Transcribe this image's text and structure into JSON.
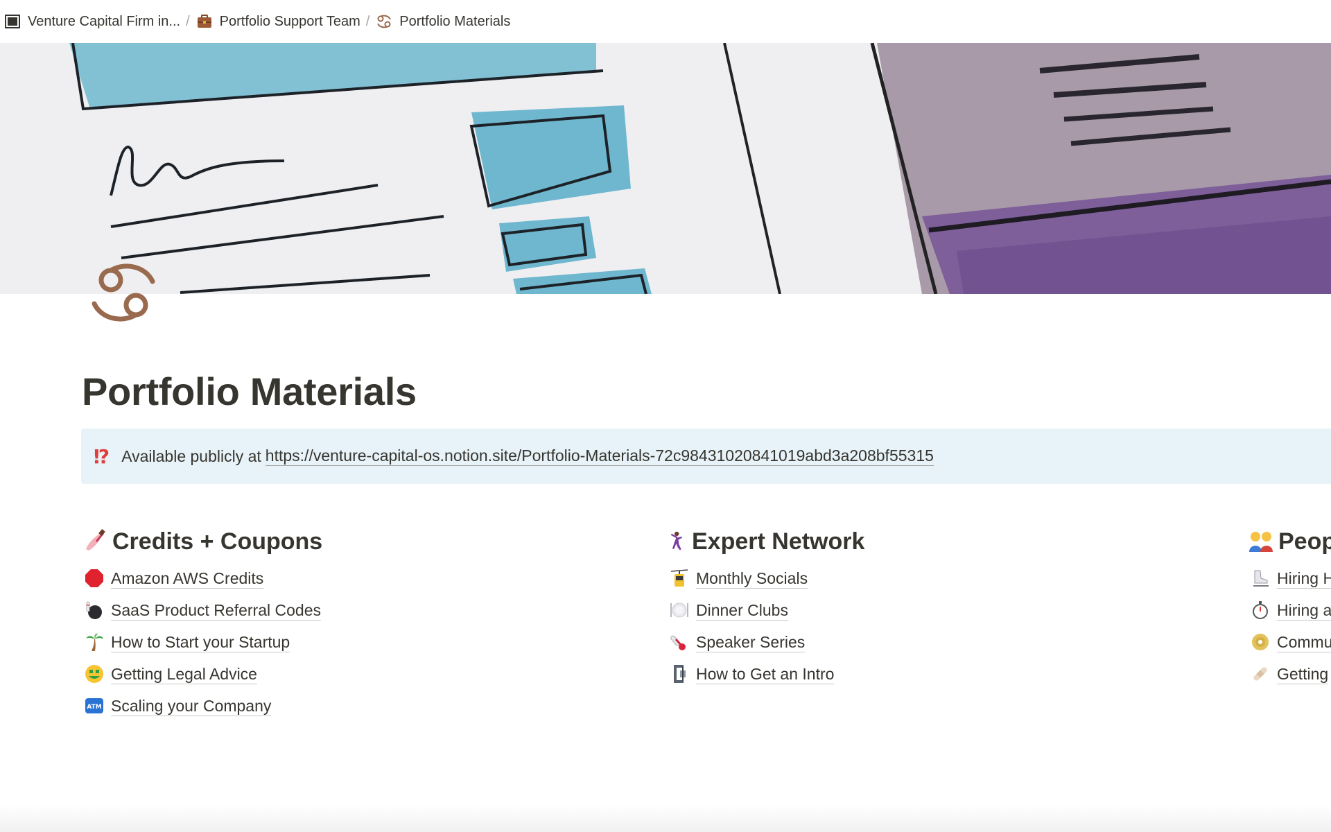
{
  "breadcrumb": [
    {
      "label": "Venture Capital Firm in...",
      "icon": "window-icon"
    },
    {
      "label": "Portfolio Support Team",
      "icon": "briefcase-icon"
    },
    {
      "label": "Portfolio Materials",
      "icon": "cancer-sign-icon"
    }
  ],
  "breadcrumb_separator": "/",
  "page": {
    "icon": "cancer-sign-icon",
    "title": "Portfolio Materials"
  },
  "callout": {
    "icon": "⁉",
    "text": "Available publicly at",
    "link": "https://venture-capital-os.notion.site/Portfolio-Materials-72c98431020841019abd3a208bf55315"
  },
  "columns": [
    {
      "heading": "Credits + Coupons",
      "heading_icon": "nail-polish-icon",
      "items": [
        {
          "label": "Amazon AWS Credits",
          "icon": "stop-sign-icon"
        },
        {
          "label": "SaaS Product Referral Codes",
          "icon": "bowling-icon"
        },
        {
          "label": "How to Start your Startup",
          "icon": "palm-tree-icon"
        },
        {
          "label": "Getting Legal Advice",
          "icon": "money-mouth-face-icon"
        },
        {
          "label": "Scaling your Company",
          "icon": "atm-sign-icon"
        }
      ]
    },
    {
      "heading": "Expert Network",
      "heading_icon": "dancing-person-icon",
      "items": [
        {
          "label": "Monthly Socials",
          "icon": "aerial-tramway-icon"
        },
        {
          "label": "Dinner Clubs",
          "icon": "plate-with-cutlery-icon"
        },
        {
          "label": "Speaker Series",
          "icon": "thermometer-icon"
        },
        {
          "label": "How to Get an Intro",
          "icon": "clamp-icon"
        }
      ]
    },
    {
      "heading": "Peop",
      "heading_icon": "people-icon",
      "items": [
        {
          "label": "Hiring H",
          "icon": "ice-skate-icon"
        },
        {
          "label": "Hiring a",
          "icon": "stopwatch-icon"
        },
        {
          "label": "Commu",
          "icon": "dvd-icon"
        },
        {
          "label": "Getting",
          "icon": "bandage-icon"
        }
      ]
    }
  ],
  "colors": {
    "text": "#37352f",
    "callout_bg": "#e7f3f8",
    "page_icon": "#9a6a4f",
    "callout_icon": "#e03e3e"
  }
}
